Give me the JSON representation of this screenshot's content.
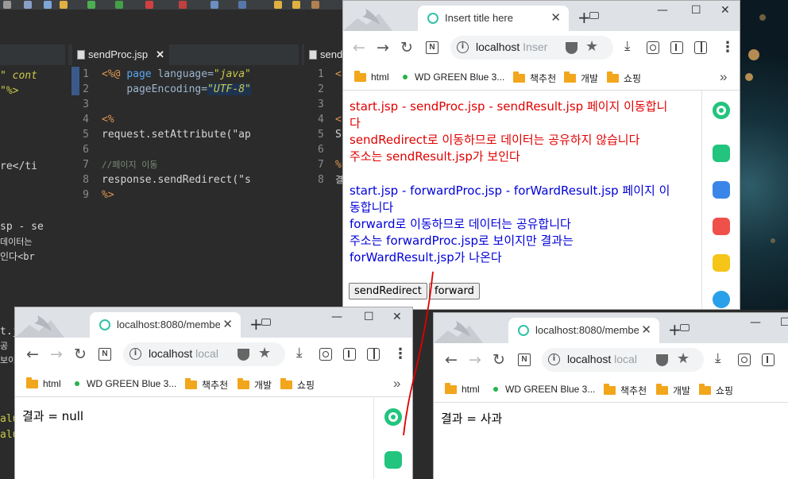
{
  "eclipse": {
    "left_editor": {
      "fragments": [
        "\" cont",
        "\"%>",
        "re</ti",
        "sp - se",
        "데이터는",
        "인다<br",
        "t.j",
        "공",
        "보이",
        "alu",
        "alu"
      ]
    },
    "center_editor": {
      "tab_label": "sendProc.jsp",
      "tab_close": "✕",
      "line_numbers": [
        "1",
        "2",
        "3",
        "4",
        "5",
        "6",
        "7",
        "8",
        "9"
      ],
      "line1_open": "<%@ ",
      "line1_kw": "page",
      "line1_attr": " language=",
      "line1_val": "\"java\"",
      "line2_attr": "pageEncoding=",
      "line2_val": "\"UTF-8\"",
      "line4": "<%",
      "line5": "request.setAttribute(\"ap",
      "line7": "//페이지 이동",
      "line8": "response.sendRedirect(\"s",
      "line9": "%>"
    },
    "right_editor": {
      "tab_label": "send",
      "line_numbers": [
        "1",
        "2",
        "3",
        "4",
        "5",
        "6",
        "7",
        "8"
      ],
      "fragments": [
        "<",
        "<",
        "S",
        "%",
        "결"
      ]
    }
  },
  "browser_main": {
    "tab_title": "Insert title here",
    "url": "localhost",
    "url_dim": "Inser",
    "bookmarks": [
      "html",
      "WD GREEN Blue 3...",
      "책추천",
      "개발",
      "쇼핑"
    ],
    "bookmarks_more": "»",
    "red_lines": [
      "start.jsp - sendProc.jsp - sendResult.jsp 페이지 이동합니",
      "다",
      "sendRedirect로 이동하므로 데이터는 공유하지 않습니다",
      "주소는 sendResult.jsp가 보인다"
    ],
    "blue_lines": [
      "start.jsp - forwardProc.jsp - forWardResult.jsp 페이지 이",
      "동합니다",
      "forward로 이동하므로 데이터는 공유합니다",
      "주소는 forwardProc.jsp로 보이지만 결과는",
      "forWardResult.jsp가 나온다"
    ],
    "buttons": {
      "send_redirect": "sendRedirect",
      "forward": "forward"
    }
  },
  "browser_left": {
    "tab_title": "localhost:8080/member",
    "url": "localhost",
    "url_dim": "local",
    "bookmarks": [
      "html",
      "WD GREEN Blue 3...",
      "책추천",
      "개발",
      "쇼핑"
    ],
    "bookmarks_more": "»",
    "result_text": "결과 = null"
  },
  "browser_right": {
    "tab_title": "localhost:8080/member",
    "url": "localhost",
    "url_dim": "local",
    "bookmarks": [
      "html",
      "WD GREEN Blue 3...",
      "책추천",
      "개발",
      "쇼핑"
    ],
    "result_text": "결과 = 사과"
  },
  "common": {
    "tab_close": "✕",
    "new_tab": "+",
    "minimize": "—",
    "maximize": "☐",
    "close": "✕",
    "back": "←",
    "forward": "→",
    "reload": "↻",
    "menu": "⋮",
    "download": "⤓",
    "info": "i",
    "n_icon": "N",
    "star": "★"
  },
  "colors": {
    "red_text": "#e00000",
    "blue_text": "#0000d8",
    "annotation_line": "#e00000",
    "sidebar_green": "#22c47e",
    "sidebar_blue": "#3a86e8",
    "sidebar_red": "#f0504a",
    "sidebar_yellow": "#f5c518"
  }
}
